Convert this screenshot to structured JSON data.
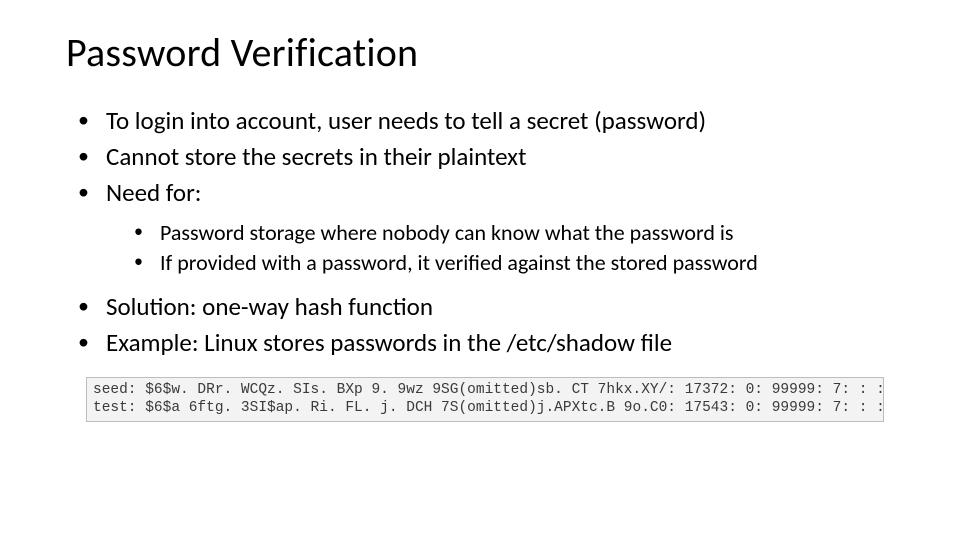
{
  "slide": {
    "title": "Password Verification",
    "bullets": [
      {
        "text": "To login into account, user needs to tell a secret (password)"
      },
      {
        "text": "Cannot store the secrets in their plaintext"
      },
      {
        "text": "Need for:",
        "children": [
          "Password storage where nobody can know what the password is",
          "If provided with a password, it verified against the stored password"
        ]
      },
      {
        "text": "Solution: one-way hash function"
      },
      {
        "text": "Example: Linux stores passwords in the /etc/shadow file"
      }
    ],
    "code": {
      "line1": "seed: $6$w. DRr. WCQz. SIs. BXp 9. 9wz 9SG(omitted)sb. CT 7hkx.XY/: 17372: 0: 99999: 7: : :",
      "line2": "test: $6$a 6ftg. 3SI$ap. Ri. FL. j. DCH 7S(omitted)j.APXtc.B 9o.C0: 17543: 0: 99999: 7: : :"
    }
  }
}
